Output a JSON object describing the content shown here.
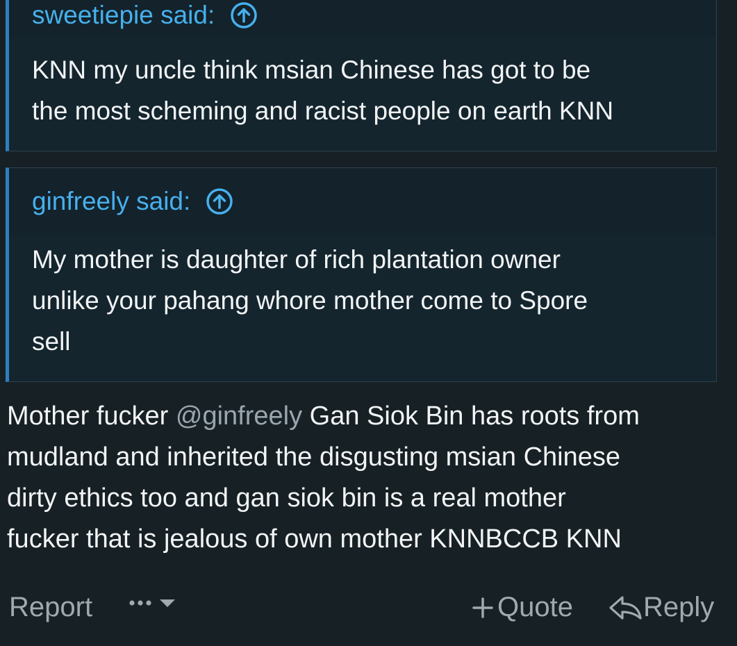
{
  "quotes": [
    {
      "author": "sweetiepie said:",
      "lines": [
        "KNN my uncle think msian Chinese has got to be",
        "the most scheming and racist people on earth KNN"
      ]
    },
    {
      "author": "ginfreely said:",
      "lines": [
        "My mother is daughter of rich plantation owner",
        "unlike your pahang whore mother come to Spore",
        "sell"
      ]
    }
  ],
  "message": {
    "line1_before": "Mother fucker ",
    "mention": "@ginfreely",
    "line1_after": " Gan Siok Bin has roots from",
    "line2": "mudland and inherited the disgusting msian Chinese",
    "line3": "dirty ethics too and gan siok bin is a real mother",
    "line4": "fucker that is jealous of own mother KNNBCCB KNN"
  },
  "footer": {
    "report": "Report",
    "quote": "Quote",
    "reply": "Reply"
  },
  "colors": {
    "background": "#172025",
    "quote_author": "#47b0ec",
    "quote_border": "#2f7fbf",
    "muted": "#9fa9ae"
  },
  "icons": {
    "jump": "arrow-up-circle-icon",
    "more": "ellipsis-icon",
    "dropdown": "caret-down-icon",
    "quote": "plus-icon",
    "reply": "reply-arrow-icon"
  }
}
